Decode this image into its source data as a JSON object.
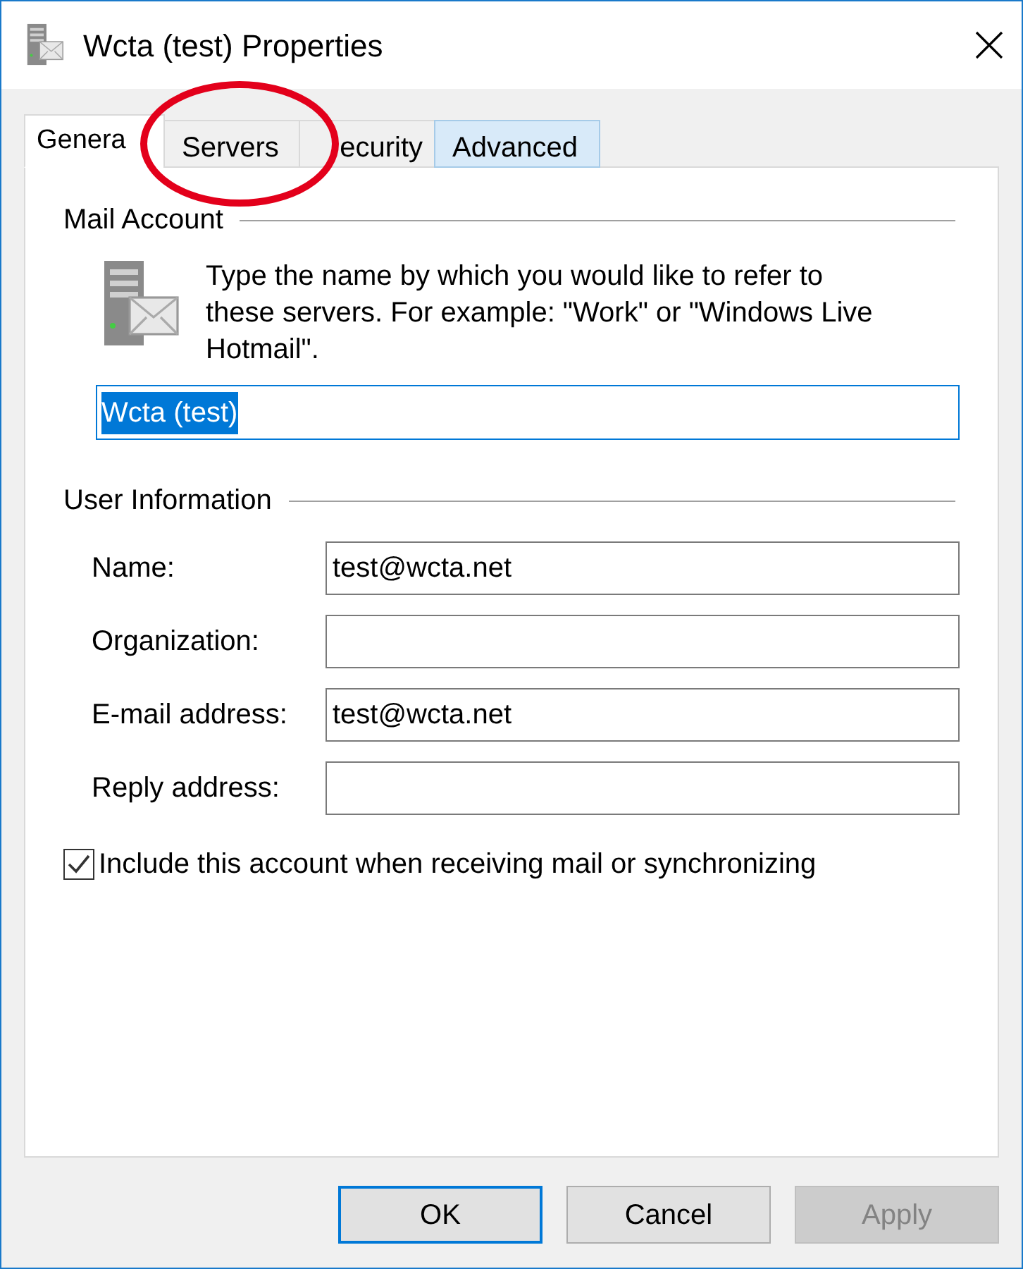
{
  "window": {
    "title": "Wcta (test) Properties"
  },
  "tabs": [
    {
      "label": "Genera",
      "selected": true,
      "hovered": false
    },
    {
      "label": "Servers",
      "selected": false,
      "hovered": false
    },
    {
      "label": "ecurity",
      "selected": false,
      "hovered": false
    },
    {
      "label": "Advanced",
      "selected": false,
      "hovered": true
    }
  ],
  "mail_account": {
    "heading": "Mail Account",
    "description": "Type the name by which you would like to refer to these servers.  For example: \"Work\" or \"Windows Live Hotmail\".",
    "value": "Wcta (test)",
    "text_selected": true
  },
  "user_information": {
    "heading": "User Information",
    "fields": [
      {
        "label": "Name:",
        "value": "test@wcta.net"
      },
      {
        "label": "Organization:"
      },
      {
        "label": "E-mail address:",
        "value": "test@wcta.net"
      },
      {
        "label": "Reply address:"
      }
    ]
  },
  "include_checkbox": {
    "label": "Include this account when receiving mail or synchronizing",
    "checked": true
  },
  "buttons": [
    {
      "label": "OK",
      "default": true,
      "disabled": false
    },
    {
      "label": "Cancel",
      "default": false,
      "disabled": false
    },
    {
      "label": "Apply",
      "default": false,
      "disabled": true
    }
  ]
}
